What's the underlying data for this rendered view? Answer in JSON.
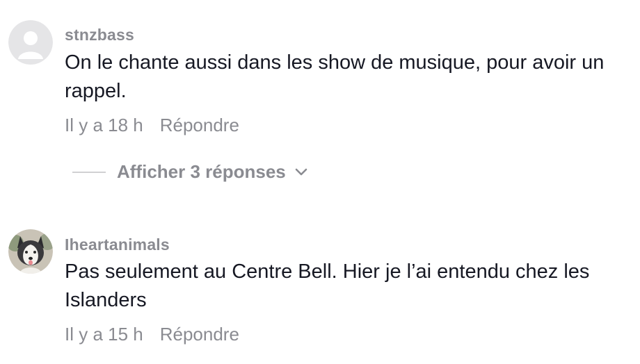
{
  "comments": [
    {
      "username": "stnzbass",
      "avatar_icon": "default-user-avatar-icon",
      "text": "On le chante aussi dans les show de musique, pour avoir un rappel.",
      "time": "Il y a 18 h",
      "reply_label": "Répondre",
      "view_replies_label": "Afficher 3 réponses"
    },
    {
      "username": "Iheartanimals",
      "avatar_icon": "husky-dog-avatar-icon",
      "text": "Pas seulement au Centre Bell. Hier je l’ai entendu chez les Islanders",
      "time": "Il y a 15 h",
      "reply_label": "Répondre"
    }
  ],
  "colors": {
    "username": "#8a8b91",
    "text": "#161823",
    "meta": "#8a8b91",
    "divider": "#d0d0d3"
  }
}
